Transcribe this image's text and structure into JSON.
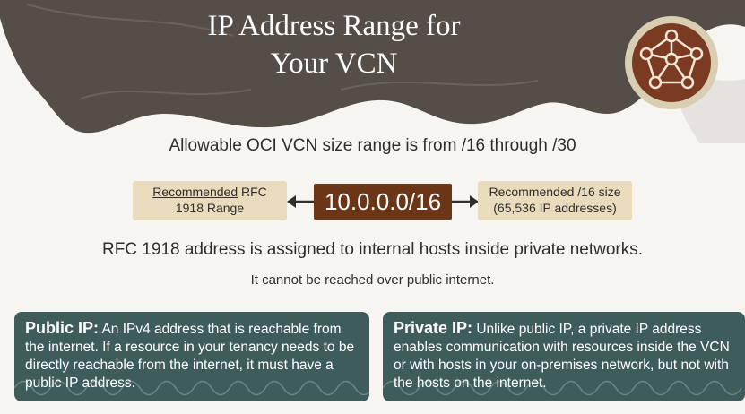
{
  "header": {
    "title_line1": "IP Address Range for",
    "title_line2": "Your VCN",
    "icon": "vcn-network-icon"
  },
  "size_range": "Allowable OCI VCN size range is from /16 through /30",
  "cidr_flow": {
    "left_underlined": "Recommended",
    "left_rest": " RFC",
    "left_line2": "1918 Range",
    "center": "10.0.0.0/16",
    "right_line1": "Recommended /16 size",
    "right_line2": "(65,536 IP addresses)"
  },
  "rfc_note": "RFC 1918 address is assigned to internal hosts inside private networks.",
  "rfc_subnote": "It cannot be reached over public internet.",
  "public_ip": {
    "label": "Public IP:",
    "text": " An IPv4 address that is reachable from the internet. If a resource in your tenancy needs to be directly reachable from the internet, it must have a public IP address."
  },
  "private_ip": {
    "label": "Private IP:",
    "text": " Unlike public IP, a private IP address enables communication with resources inside the VCN or with hosts in your on-premises network, but not with the hosts on the internet."
  },
  "colors": {
    "banner": "#544d48",
    "accent_brown": "#6b3518",
    "pill": "#e8dcbd",
    "card": "#3d5c5a"
  }
}
